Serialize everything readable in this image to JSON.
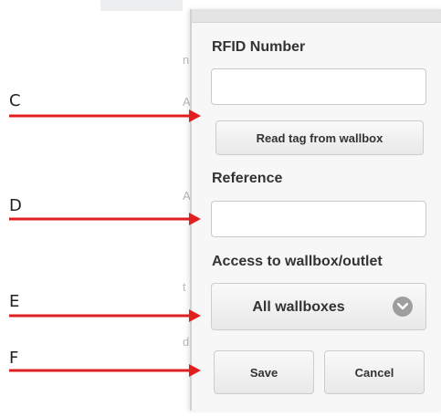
{
  "form": {
    "rfid_label": "RFID Number",
    "rfid_value": "",
    "read_tag_label": "Read tag from wallbox",
    "reference_label": "Reference",
    "reference_value": "",
    "access_label": "Access to wallbox/outlet",
    "access_selected": "All wallboxes",
    "save_label": "Save",
    "cancel_label": "Cancel"
  },
  "annotations": {
    "c": "C",
    "d": "D",
    "e": "E",
    "f": "F",
    "arrow_color": "#e02020"
  },
  "colors": {
    "panel_bg": "#f7f7f7",
    "label_text": "#333333",
    "chevron_bg": "#9e9e9e"
  },
  "icons": {
    "access_select": "chevron-down-icon"
  }
}
